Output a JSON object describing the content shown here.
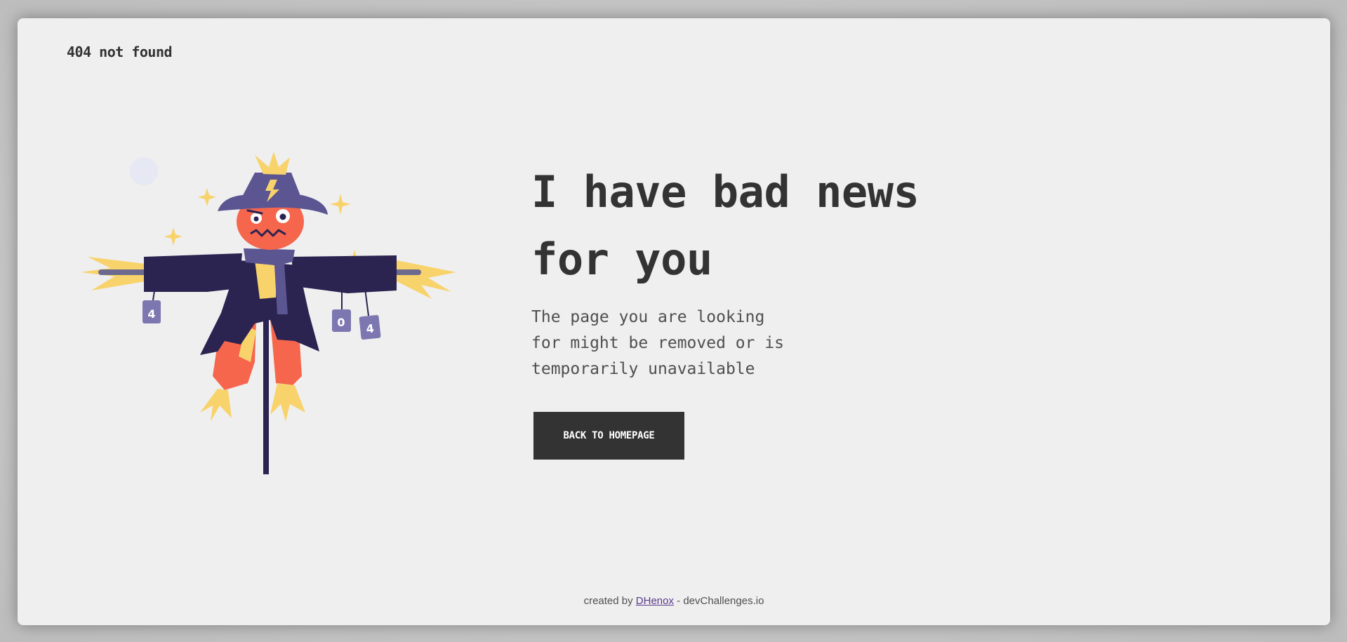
{
  "header": {
    "brand": "404 not found"
  },
  "illustration": {
    "can_labels": [
      "4",
      "0",
      "4"
    ],
    "colors": {
      "coat": "#2b2350",
      "hat": "#5b5592",
      "face": "#f5664d",
      "straw": "#f8d36b",
      "can": "#7c77b0",
      "moon": "#e6e8f4"
    }
  },
  "main": {
    "headline": "I have bad news for you",
    "description": "The page you are looking for might be removed or is temporarily unavailable",
    "button_label": "BACK TO HOMEPAGE"
  },
  "footer": {
    "prefix": "created by ",
    "author": "DHenox",
    "suffix": " - devChallenges.io"
  },
  "colors": {
    "background": "#efefef",
    "text": "#333333",
    "button": "#333333"
  }
}
